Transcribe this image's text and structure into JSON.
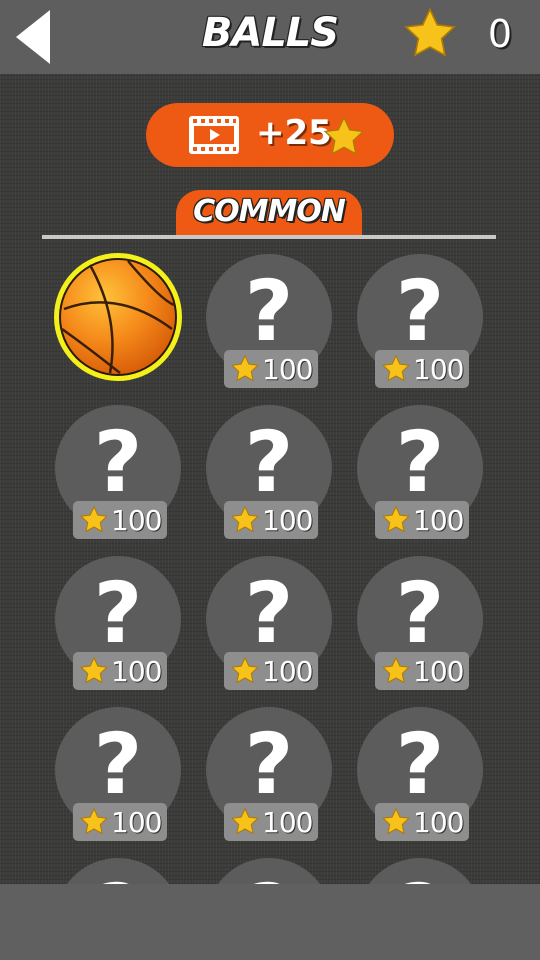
{
  "header": {
    "title": "BALLS",
    "star_count": "0",
    "back_icon": "back-arrow-icon",
    "star_icon": "star-icon"
  },
  "video_reward": {
    "label": "+25",
    "icon": "video-film-icon",
    "star_icon": "star-icon"
  },
  "tab": {
    "label": "COMMON"
  },
  "colors": {
    "accent": "#ee5a13",
    "star": "#f7c21a",
    "selected_ring": "#f4f01c",
    "slot_bg": "#5c5c5c",
    "price_bg": "#8e8e8e",
    "topbar": "#5e5e5e"
  },
  "balls": {
    "selected": {
      "name": "basketball",
      "state": "owned-selected"
    },
    "locked_symbol": "?",
    "locked": [
      {
        "price": "100"
      },
      {
        "price": "100"
      },
      {
        "price": "100"
      },
      {
        "price": "100"
      },
      {
        "price": "100"
      },
      {
        "price": "100"
      },
      {
        "price": "100"
      },
      {
        "price": "100"
      },
      {
        "price": "100"
      },
      {
        "price": "100"
      },
      {
        "price": "100"
      }
    ]
  }
}
